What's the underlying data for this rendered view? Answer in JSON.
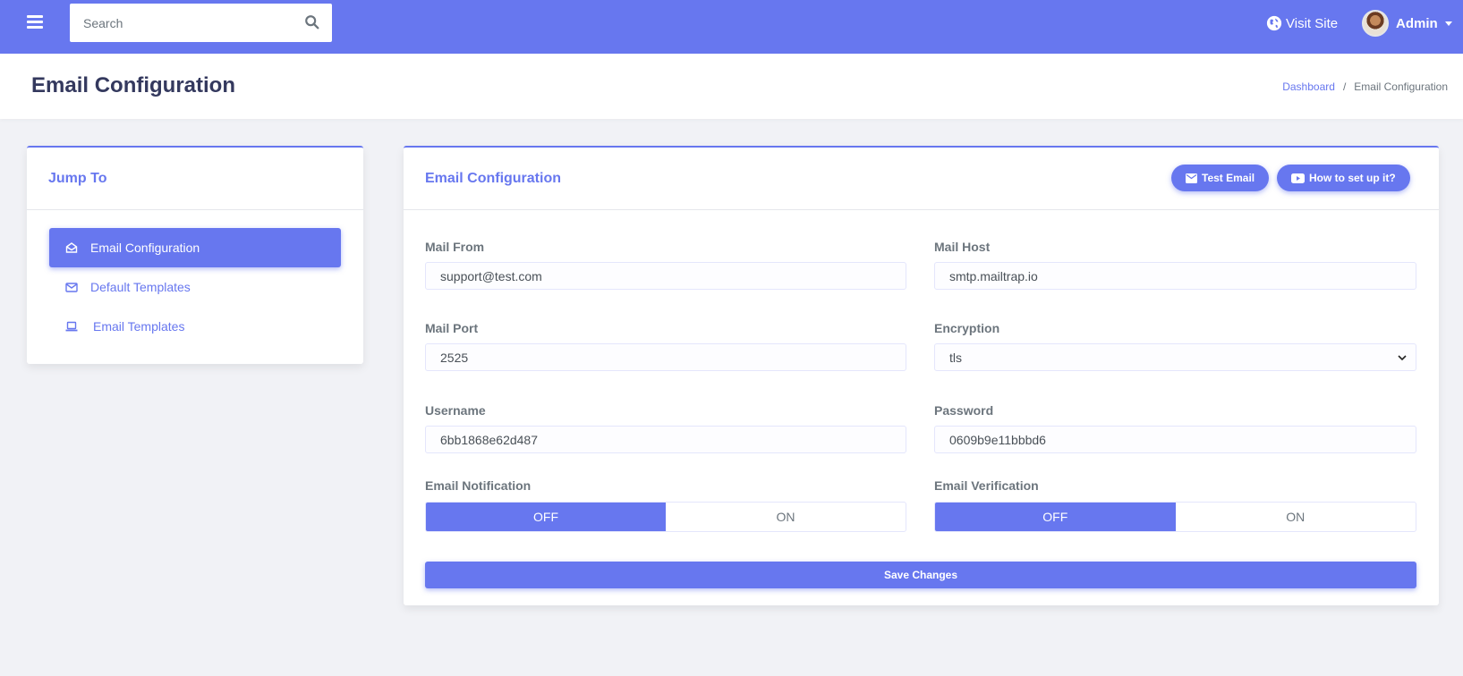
{
  "navbar": {
    "search_placeholder": "Search",
    "visit_site": "Visit Site",
    "user_name": "Admin",
    "accent_color": "#6777ef"
  },
  "page": {
    "title": "Email Configuration",
    "breadcrumb": [
      "Dashboard",
      "Email Configuration"
    ]
  },
  "jump_to": {
    "title": "Jump To",
    "items": [
      {
        "label": "Email Configuration",
        "icon": "envelope-open-icon",
        "active": true
      },
      {
        "label": "Default Templates",
        "icon": "envelope-icon",
        "active": false
      },
      {
        "label": "Email Templates",
        "icon": "laptop-icon",
        "active": false
      }
    ]
  },
  "config": {
    "title": "Email Configuration",
    "test_email_button": "Test Email",
    "howto_button": "How to set up it?",
    "fields": {
      "mail_from": {
        "label": "Mail From",
        "value": "support@test.com"
      },
      "mail_host": {
        "label": "Mail Host",
        "value": "smtp.mailtrap.io"
      },
      "mail_port": {
        "label": "Mail Port",
        "value": "2525"
      },
      "encryption": {
        "label": "Encryption",
        "value": "tls"
      },
      "username": {
        "label": "Username",
        "value": "6bb1868e62d487"
      },
      "password": {
        "label": "Password",
        "value": "0609b9e11bbbd6"
      }
    },
    "email_notification": {
      "label": "Email Notification",
      "off": "OFF",
      "on": "ON",
      "selected": "OFF"
    },
    "email_verification": {
      "label": "Email Verification",
      "off": "OFF",
      "on": "ON",
      "selected": "OFF"
    },
    "save_button": "Save Changes"
  }
}
